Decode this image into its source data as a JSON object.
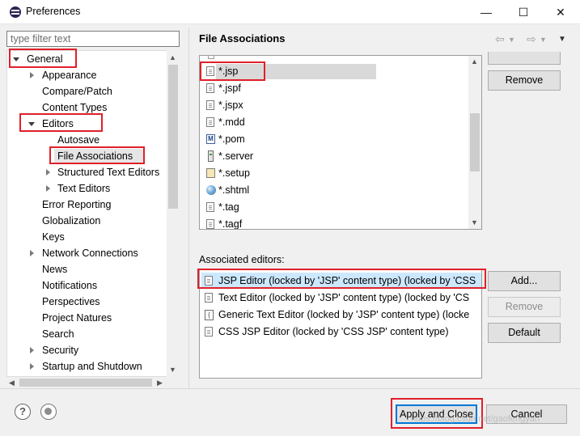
{
  "window": {
    "title": "Preferences",
    "controls": {
      "minimize": "—",
      "maximize": "☐",
      "close": "✕"
    }
  },
  "sidebar": {
    "filter_placeholder": "type filter text",
    "items": [
      {
        "label": "General",
        "expanded": true
      },
      {
        "label": "Appearance"
      },
      {
        "label": "Compare/Patch"
      },
      {
        "label": "Content Types"
      },
      {
        "label": "Editors",
        "expanded": true
      },
      {
        "label": "Autosave"
      },
      {
        "label": "File Associations",
        "selected": true
      },
      {
        "label": "Structured Text Editors"
      },
      {
        "label": "Text Editors"
      },
      {
        "label": "Error Reporting"
      },
      {
        "label": "Globalization"
      },
      {
        "label": "Keys"
      },
      {
        "label": "Network Connections"
      },
      {
        "label": "News"
      },
      {
        "label": "Notifications"
      },
      {
        "label": "Perspectives"
      },
      {
        "label": "Project Natures"
      },
      {
        "label": "Search"
      },
      {
        "label": "Security"
      },
      {
        "label": "Startup and Shutdown"
      }
    ]
  },
  "page": {
    "title": "File Associations",
    "file_types": [
      {
        "label": "*.jsp",
        "icon": "text-file-icon",
        "selected": true
      },
      {
        "label": "*.jspf",
        "icon": "text-file-icon"
      },
      {
        "label": "*.jspx",
        "icon": "text-file-icon"
      },
      {
        "label": "*.mdd",
        "icon": "text-file-icon"
      },
      {
        "label": "*.pom",
        "icon": "maven-icon",
        "badge": "M"
      },
      {
        "label": "*.server",
        "icon": "server-icon"
      },
      {
        "label": "*.setup",
        "icon": "setup-icon"
      },
      {
        "label": "*.shtml",
        "icon": "globe-icon"
      },
      {
        "label": "*.tag",
        "icon": "text-file-icon"
      },
      {
        "label": "*.tagf",
        "icon": "text-file-icon"
      }
    ],
    "remove_label": "Remove",
    "associated_editors_label": "Associated editors:",
    "editors": [
      {
        "label": "JSP Editor (locked by 'JSP' content type) (locked by 'CSS",
        "selected": true
      },
      {
        "label": "Text Editor (locked by 'JSP' content type) (locked by 'CS"
      },
      {
        "label": "Generic Text Editor (locked by 'JSP' content type) (locke"
      },
      {
        "label": "CSS JSP Editor (locked by 'CSS JSP' content type)"
      }
    ],
    "add_label": "Add...",
    "editor_remove_label": "Remove",
    "default_label": "Default"
  },
  "footer": {
    "apply_close_label": "Apply and Close",
    "cancel_label": "Cancel",
    "help_glyph": "?",
    "watermark": "https://blog.csdn.net/gaofengyan"
  },
  "colors": {
    "highlight_box": "#e0202a",
    "selection_blue": "#cce8ff",
    "focus_border": "#0078d7"
  }
}
